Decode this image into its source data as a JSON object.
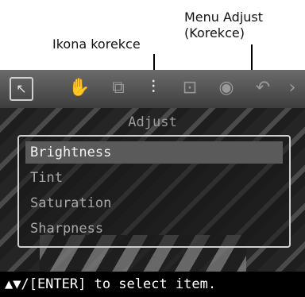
{
  "callouts": {
    "icon_label": "Ikona korekce",
    "menu_label_line1": "Menu Adjust",
    "menu_label_line2": "(Korekce)"
  },
  "toolbar": {
    "icons": [
      "select-icon",
      "hand-icon",
      "layout-icon",
      "adjust-icon",
      "edit-icon",
      "circle-icon",
      "undo-icon",
      "next-icon"
    ],
    "glyphs": {
      "select": "↖",
      "hand": "✋",
      "layout": "⧉",
      "adjust": "⫶",
      "edit": "⊡",
      "circle": "◉",
      "undo": "↶",
      "next": "›"
    }
  },
  "menu": {
    "title": "Adjust",
    "items": [
      {
        "label": "Brightness",
        "selected": true
      },
      {
        "label": "Tint",
        "selected": false
      },
      {
        "label": "Saturation",
        "selected": false
      },
      {
        "label": "Sharpness",
        "selected": false
      }
    ]
  },
  "status": {
    "text": "▲▼/[ENTER] to select item."
  },
  "colors": {
    "toolbar": "#4a4a4a",
    "selected_row": "#5a5a5a",
    "menu_border": "#cfcfcf"
  }
}
